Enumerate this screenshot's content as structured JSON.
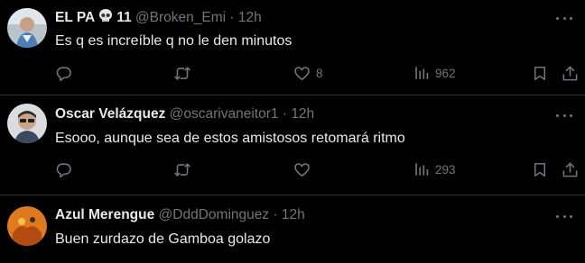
{
  "tweets": [
    {
      "name": "EL PA",
      "name_suffix": "11",
      "handle": "@Broken_Emi",
      "dot": "·",
      "time": "12h",
      "text": "Es q es increíble q no le den minutos",
      "reply_count": "",
      "retweet_count": "",
      "like_count": "8",
      "view_count": "962"
    },
    {
      "name": "Oscar Velázquez",
      "handle": "@oscarivaneitor1",
      "dot": "·",
      "time": "12h",
      "text": "Esooo, aunque sea de estos amistosos retomará ritmo",
      "reply_count": "",
      "retweet_count": "",
      "like_count": "",
      "view_count": "293"
    },
    {
      "name": "Azul Merengue",
      "handle": "@DddDominguez",
      "dot": "·",
      "time": "12h",
      "text": "Buen zurdazo de Gamboa golazo"
    }
  ],
  "icons": {
    "reply": "reply-icon",
    "retweet": "retweet-icon",
    "like": "heart-icon",
    "views": "views-icon",
    "bookmark": "bookmark-icon",
    "share": "share-icon",
    "more": "more-icon",
    "skull": "skull-emoji"
  },
  "colors": {
    "background": "#000000",
    "text": "#e7e9ea",
    "muted": "#71767b",
    "divider": "#2f3336"
  }
}
